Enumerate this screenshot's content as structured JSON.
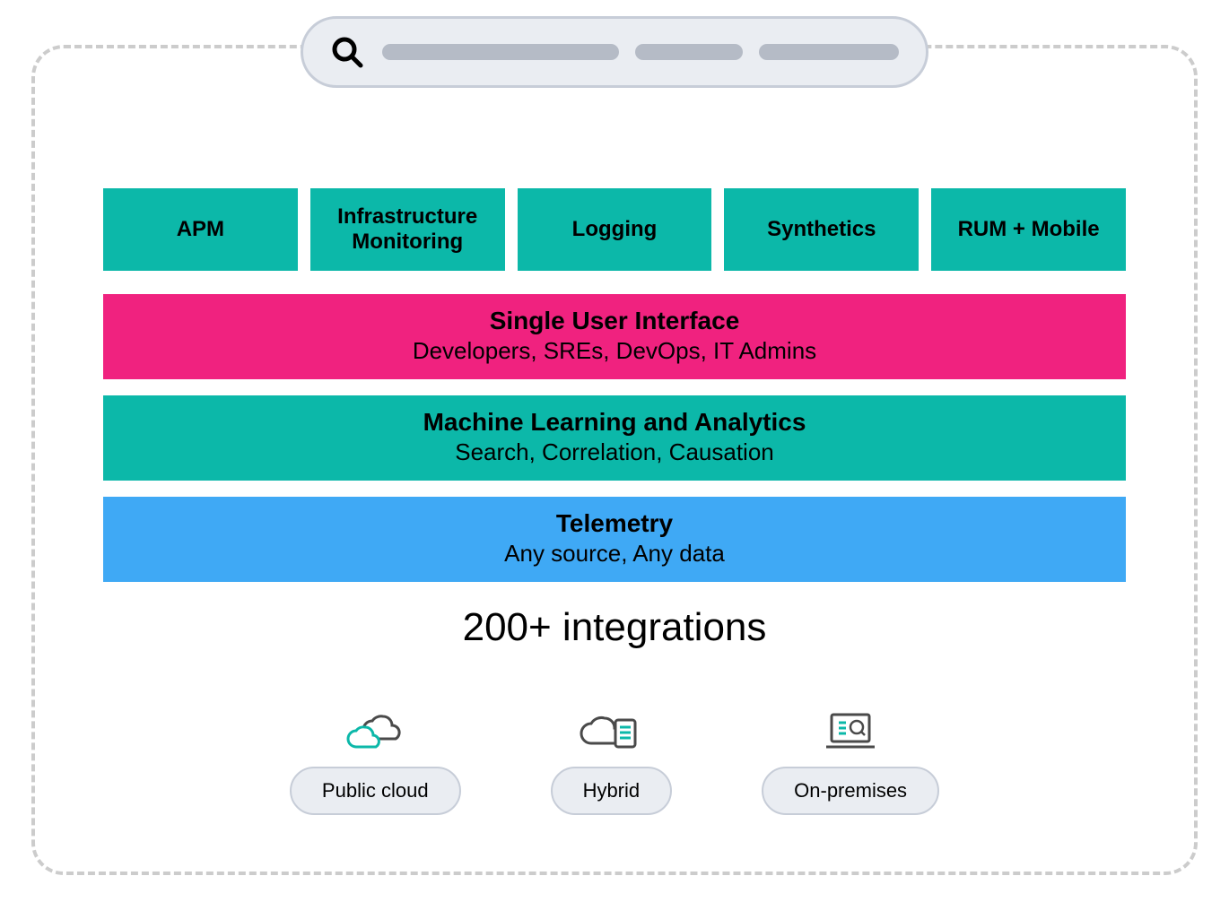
{
  "colors": {
    "teal": "#0cb8a9",
    "pink": "#f0227f",
    "blue": "#3fa9f5",
    "grayBg": "#eaedf2",
    "grayBorder": "#c7cdd8",
    "pillGray": "#b5bbc6"
  },
  "tiles": {
    "apm": "APM",
    "infra": "Infrastructure Monitoring",
    "logging": "Logging",
    "synthetics": "Synthetics",
    "rum": "RUM + Mobile"
  },
  "bars": {
    "ui": {
      "title": "Single User Interface",
      "sub": "Developers, SREs, DevOps, IT Admins"
    },
    "ml": {
      "title": "Machine Learning and Analytics",
      "sub": "Search, Correlation, Causation"
    },
    "tel": {
      "title": "Telemetry",
      "sub": "Any source, Any data"
    }
  },
  "integrations_label": "200+ integrations",
  "deployment": {
    "public": "Public cloud",
    "hybrid": "Hybrid",
    "onprem": "On-premises"
  }
}
